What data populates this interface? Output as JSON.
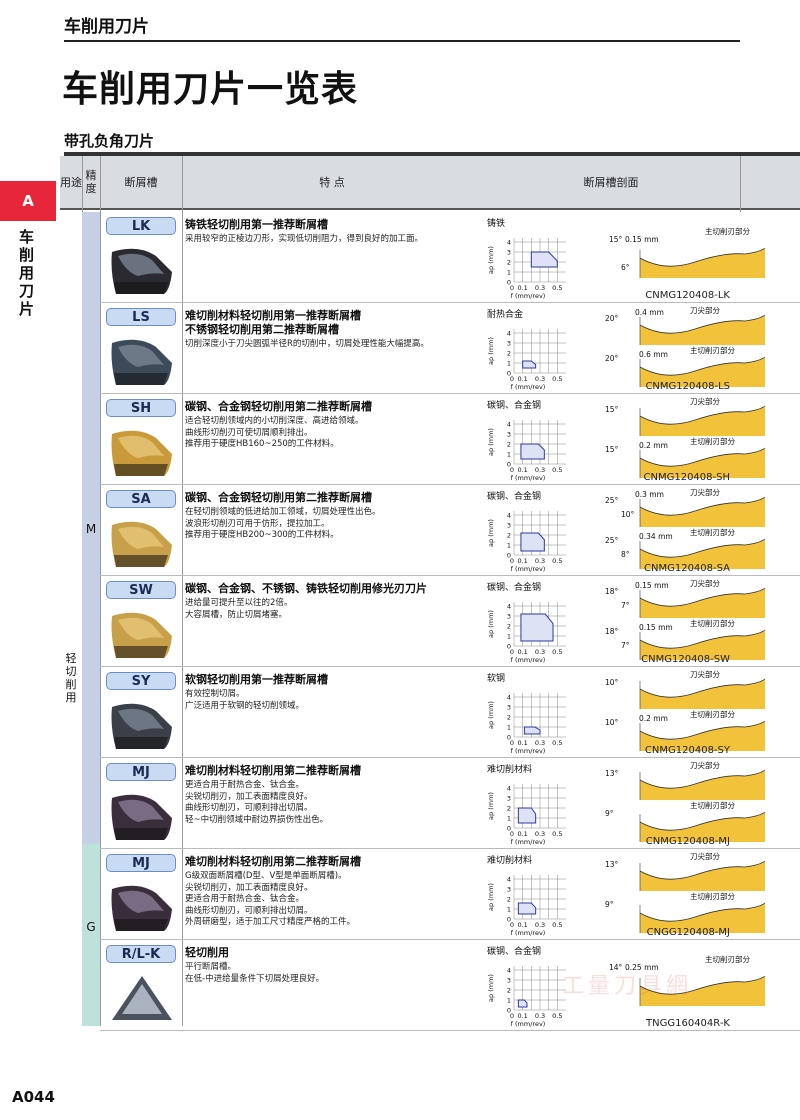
{
  "header": {
    "title": "车削用刀片"
  },
  "page_title": "车削用刀片一览表",
  "section_title": "带孔负角刀片",
  "side": {
    "tab": "A",
    "label": "车削用刀片"
  },
  "table": {
    "headers": {
      "use": "用途",
      "precision": "精度",
      "breaker": "断屑槽",
      "features": "特 点",
      "profile": "断屑槽剖面"
    },
    "use_value": "轻切削用",
    "precision_m": "M",
    "precision_g": "G",
    "rows": [
      {
        "code": "LK",
        "insert_color": "#2a2a30",
        "insert_type": "cnmg-dark",
        "title": [
          "铸铁轻切削用第一推荐断屑槽"
        ],
        "desc": [
          "采用较窄的正棱边刀形，实现低切削阻力，得到良好的加工面。"
        ],
        "material": "铸铁",
        "area_d": [
          0.2,
          0.5,
          1.5,
          3.0
        ],
        "profile_labels": {
          "angle1": "15°",
          "land": "0.15 mm",
          "part": "主切削刃部分",
          "angle2": "6°"
        },
        "model": "CNMG120408-LK"
      },
      {
        "code": "LS",
        "insert_color": "#3d4a5a",
        "insert_type": "cnmg-dark",
        "title": [
          "难切削材料轻切削用第一推荐断屑槽",
          "不锈钢轻切削用第二推荐断屑槽"
        ],
        "desc": [
          "切削深度小于刀尖圆弧半径R的切削中，切屑处理性能大幅提高。"
        ],
        "material": "耐热合金",
        "area_d": [
          0.1,
          0.25,
          0.5,
          1.2
        ],
        "profile_labels": {
          "angle1": "20°",
          "land": "0.4 mm",
          "part": "刀尖部分",
          "angle2": "20°",
          "land2": "0.6 mm",
          "part2": "主切削刃部分"
        },
        "model": "CNMG120408-LS"
      },
      {
        "code": "SH",
        "insert_color": "#c99a3a",
        "insert_type": "cnmg-gold",
        "title": [
          "碳钢、合金钢轻切削用第二推荐断屑槽"
        ],
        "desc": [
          "适合轻切削领域内的小切削深度、高进给领域。",
          "曲线形切削刃可使切屑顺利排出。",
          "推荐用于硬度HB160~250的工件材料。"
        ],
        "material": "碳钢、合金钢",
        "area_d": [
          0.08,
          0.35,
          0.5,
          2.0
        ],
        "profile_labels": {
          "angle1": "15°",
          "part": "刀尖部分",
          "angle2": "15°",
          "land2": "0.2 mm",
          "part2": "主切削刃部分"
        },
        "model": "CNMG120408-SH"
      },
      {
        "code": "SA",
        "insert_color": "#c9a04a",
        "insert_type": "cnmg-gold",
        "title": [
          "碳钢、合金钢轻切削用第二推荐断屑槽"
        ],
        "desc": [
          "在轻切削领域的低进给加工领域，切屑处理性出色。",
          "波浪形切削刃可用于仿形，提拉加工。",
          "推荐用于硬度HB200~300的工件材料。"
        ],
        "material": "碳钢、合金钢",
        "area_d": [
          0.08,
          0.35,
          0.4,
          2.2
        ],
        "profile_labels": {
          "angle1": "25°",
          "land": "0.3 mm",
          "part": "刀尖部分",
          "angle1b": "10°",
          "angle2": "25°",
          "land2": "0.34 mm",
          "part2": "主切削刃部分",
          "angle2b": "8°"
        },
        "model": "CNMG120408-SA"
      },
      {
        "code": "SW",
        "insert_color": "#c9a04a",
        "insert_type": "cnmg-gold",
        "title": [
          "碳钢、合金钢、不锈钢、铸铁轻切削用修光刃刀片"
        ],
        "desc": [
          "进给量可提升至以往的2倍。",
          "大容屑槽，防止切屑堵塞。"
        ],
        "material": "碳钢、合金钢",
        "area_d": [
          0.08,
          0.45,
          0.5,
          3.2
        ],
        "profile_labels": {
          "angle1": "18°",
          "land": "0.15 mm",
          "part": "刀尖部分",
          "angle1b": "7°",
          "angle2": "18°",
          "land2": "0.15 mm",
          "part2": "主切削刃部分",
          "angle2b": "7°"
        },
        "model": "CNMG120408-SW"
      },
      {
        "code": "SY",
        "insert_color": "#3a3f48",
        "insert_type": "cnmg-dark",
        "title": [
          "软钢轻切削用第一推荐断屑槽"
        ],
        "desc": [
          "有效控制切屑。",
          "广泛适用于软钢的轻切削领域。"
        ],
        "material": "软钢",
        "area_d": [
          0.12,
          0.3,
          0.3,
          1.0
        ],
        "profile_labels": {
          "angle1": "10°",
          "part": "刀尖部分",
          "angle2": "10°",
          "land2": "0.2 mm",
          "part2": "主切削刃部分"
        },
        "model": "CNMG120408-SY"
      },
      {
        "code": "MJ",
        "insert_color": "#3b2e3c",
        "insert_type": "cnmg-purple",
        "title": [
          "难切削材料轻切削用第二推荐断屑槽"
        ],
        "desc": [
          "更适合用于耐热合金、钛合金。",
          "尖锐切削刃，加工表面精度良好。",
          "曲线形切削刃，可顺利排出切屑。",
          "轻~中切削领域中耐边界损伤性出色。"
        ],
        "material": "难切削材料",
        "area_d": [
          0.05,
          0.25,
          0.5,
          2.0
        ],
        "profile_labels": {
          "angle1": "13°",
          "part": "刀尖部分",
          "angle2": "9°",
          "part2": "主切削刃部分"
        },
        "model": "CNMG120408-MJ"
      },
      {
        "code": "MJ",
        "insert_color": "#3b2e3c",
        "insert_type": "cnmg-purple",
        "title": [
          "难切削材料轻切削用第二推荐断屑槽"
        ],
        "desc": [
          "G级双面断屑槽(D型、V型是单面断屑槽)。",
          "尖锐切削刃，加工表面精度良好。",
          "更适合用于耐热合金、钛合金。",
          "曲线形切削刃，可顺利排出切屑。",
          "外周研磨型，适于加工尺寸精度严格的工件。"
        ],
        "material": "难切削材料",
        "area_d": [
          0.05,
          0.25,
          0.5,
          1.6
        ],
        "profile_labels": {
          "angle1": "13°",
          "part": "刀尖部分",
          "angle2": "9°",
          "part2": "主切削刃部分"
        },
        "model": "CNGG120408-MJ"
      },
      {
        "code": "R/L-K",
        "insert_color": "#6a7280",
        "insert_type": "tngg",
        "title": [
          "轻切削用"
        ],
        "desc": [
          "平行断屑槽。",
          "在低-中进给量条件下切屑处理良好。"
        ],
        "material": "碳钢、合金钢",
        "area_d": [
          0.05,
          0.15,
          0.3,
          1.0
        ],
        "profile_labels": {
          "part": "主切削刃部分",
          "land": "0.25 mm",
          "angle1": "14°"
        },
        "model": "TNGG160404R-K"
      }
    ],
    "mini_chart": {
      "ylabel": "ap (mm)",
      "xlabel": "f (mm/rev)",
      "yticks": [
        "4",
        "3",
        "2",
        "1",
        "0"
      ],
      "xticks": [
        "0.1",
        "0.3",
        "0.5"
      ]
    }
  },
  "watermark": "工量刀具網",
  "page_number": "A044"
}
